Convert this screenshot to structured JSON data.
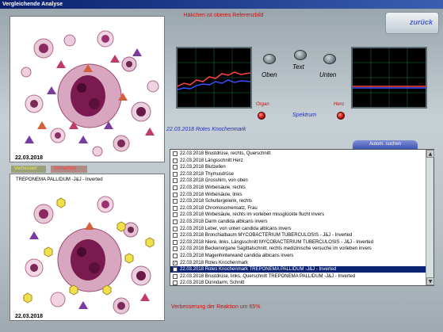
{
  "window": {
    "title": "Vergleichende Analyse"
  },
  "header": {
    "hint": "Häkchen ist oberes Referenzbild",
    "back_label": "zurück"
  },
  "panels": {
    "top": {
      "date": "22.03.2018"
    },
    "bottom": {
      "date": "22.03.2018",
      "caption": "TREPONEMA  PALLIDUM  -J&J - Inverted"
    }
  },
  "tabs": {
    "improved": "Verbessert",
    "worse": "Schlechter"
  },
  "controls": {
    "up": "Oben",
    "text": "Text",
    "down": "Unten",
    "organ": "Organ",
    "hero": "Hero",
    "spectrum": "Spektrum"
  },
  "info_line": "22.03.2018 Rotes Knochenmark",
  "search_button": "Autom. suchen",
  "colors": {
    "accent": "#0a2473",
    "red": "#cc1010",
    "yellow_tab": "#e8e84a"
  },
  "list": [
    {
      "text": "22.03.2018  Brustdrüse, rechts, Querschnitt",
      "checked": false,
      "selected": false
    },
    {
      "text": "22.03.2018  Längsschnitt Herz",
      "checked": false,
      "selected": false
    },
    {
      "text": "22.03.2018  Blutzellen",
      "checked": false,
      "selected": false
    },
    {
      "text": "22.03.2018  Thymusdrüse",
      "checked": false,
      "selected": false
    },
    {
      "text": "22.03.2018  Grosshirn, von oben",
      "checked": false,
      "selected": false
    },
    {
      "text": "22.03.2018  Wirbelsäule, rechts",
      "checked": false,
      "selected": false
    },
    {
      "text": "22.03.2018  Wirbelsäule, links",
      "checked": false,
      "selected": false
    },
    {
      "text": "22.03.2018  Schultergelenk, rechts",
      "checked": false,
      "selected": false
    },
    {
      "text": "22.03.2018  Chromosomensatz, Frau",
      "checked": false,
      "selected": false
    },
    {
      "text": "22.03.2018  Wirbelsäule, rechts  im vorleben missglückte flucht invers",
      "checked": false,
      "selected": false
    },
    {
      "text": "22.03.2018  Darm  candida albicans invers",
      "checked": false,
      "selected": false
    },
    {
      "text": "22.03.2018  Leber, von unten  candida albicans invers",
      "checked": false,
      "selected": false
    },
    {
      "text": "22.03.2018  Bronchialbaum  MYCOBACTERIUM  TUBERCULOSIS  - J&J - Inverted",
      "checked": false,
      "selected": false
    },
    {
      "text": "22.03.2018  Niere, links, Längsschnitt  MYCOBACTERIUM  TUBERCULOSIS  - J&J - Inverted",
      "checked": false,
      "selected": false
    },
    {
      "text": "22.03.2018  Beckenorgane Sagittalschnitt, rechts  medizinische versuche im vorleben invers",
      "checked": false,
      "selected": false
    },
    {
      "text": "22.03.2018  Magenhinterwand  candida albicans invers",
      "checked": false,
      "selected": false
    },
    {
      "text": "22.03.2018  Rotes Knochenmark",
      "checked": true,
      "selected": false
    },
    {
      "text": "22.03.2018  Rotes Knochenmark  TREPONEMA  PALLIDUM  -J&J - Inverted",
      "checked": false,
      "selected": true
    },
    {
      "text": "22.03.2018  Brustdrüse, links, Querschnitt  TREPONEMA  PALLIDUM  -J&J - Inverted",
      "checked": false,
      "selected": false
    },
    {
      "text": "22.03.2018  Dünndarm, Schnitt",
      "checked": false,
      "selected": false
    }
  ],
  "status": "Verbesserung der Reaktion um 65%"
}
